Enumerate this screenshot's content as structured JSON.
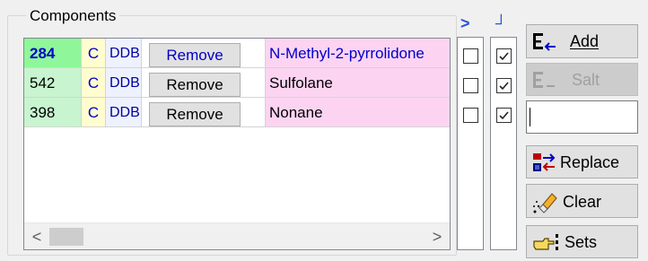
{
  "group": {
    "title": "Components"
  },
  "grid": {
    "rows": [
      {
        "id": "284",
        "phase": "C",
        "source": "DDB",
        "remove_label": "Remove",
        "name": "N-Methyl-2-pyrrolidone",
        "col1_checked": false,
        "col2_checked": true
      },
      {
        "id": "542",
        "phase": "C",
        "source": "DDB",
        "remove_label": "Remove",
        "name": "Sulfolane",
        "col1_checked": false,
        "col2_checked": true
      },
      {
        "id": "398",
        "phase": "C",
        "source": "DDB",
        "remove_label": "Remove",
        "name": "Nonane",
        "col1_checked": false,
        "col2_checked": true
      }
    ],
    "scroll_left": "<",
    "scroll_right": ">"
  },
  "columns": {
    "col1_header": ">",
    "col2_header": "┘"
  },
  "buttons": {
    "add": "Add",
    "salt": "Salt",
    "replace": "Replace",
    "clear": "Clear",
    "sets": "Sets"
  },
  "search": {
    "value": ""
  },
  "colors": {
    "id_bold_bg": "#8ff79a",
    "id_bg": "#c8f5cf",
    "phase_bg": "#fffdd0",
    "source_bg": "#eef2ff",
    "name_bg": "#fcd4f2",
    "accent_blue": "#0000c8"
  }
}
